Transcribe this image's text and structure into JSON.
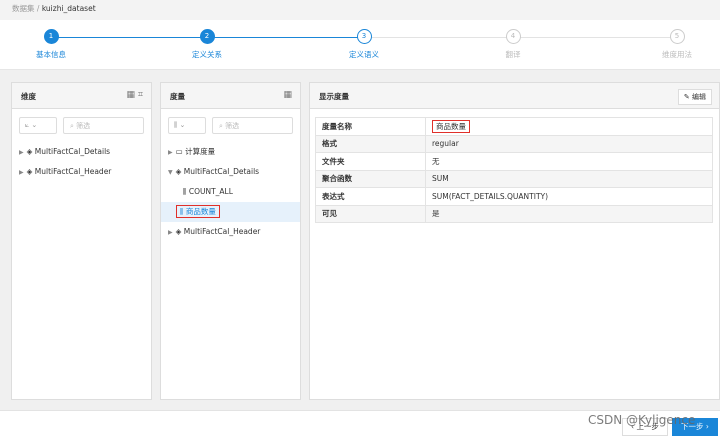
{
  "breadcrumb": {
    "root": "数据集",
    "sep": "/",
    "current": "kuizhi_dataset"
  },
  "steps": [
    {
      "num": "1",
      "label": "基本信息"
    },
    {
      "num": "2",
      "label": "定义关系"
    },
    {
      "num": "3",
      "label": "定义语义"
    },
    {
      "num": "4",
      "label": "翻译"
    },
    {
      "num": "5",
      "label": "维度用法"
    }
  ],
  "dim_panel": {
    "title": "维度",
    "filter_placeholder": "筛选",
    "items": [
      "MultiFactCal_Details",
      "MultiFactCal_Header"
    ]
  },
  "measure_panel": {
    "title": "度量",
    "filter_placeholder": "筛选",
    "calc": "计算度量",
    "group1": "MultiFactCal_Details",
    "children": [
      "COUNT_ALL",
      "商品数量"
    ],
    "group2": "MultiFactCal_Header"
  },
  "detail": {
    "title": "显示度量",
    "edit": "编辑",
    "rows": [
      [
        "度量名称",
        "商品数量"
      ],
      [
        "格式",
        "regular"
      ],
      [
        "文件夹",
        "无"
      ],
      [
        "聚合函数",
        "SUM"
      ],
      [
        "表达式",
        "SUM(FACT_DETAILS.QUANTITY)"
      ],
      [
        "可见",
        "是"
      ]
    ]
  },
  "footer": {
    "prev": "上一步",
    "next": "下一步",
    "watermark": "CSDN @Kyligence"
  },
  "colors": {
    "accent": "#1a86d8",
    "highlight": "#e0302a"
  }
}
